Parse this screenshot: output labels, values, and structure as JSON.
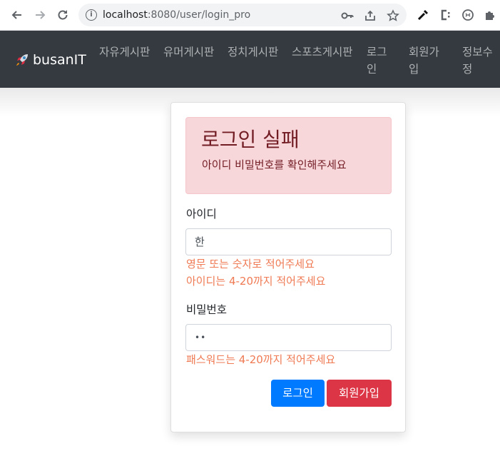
{
  "browser": {
    "url_host": "localhost",
    "url_rest": ":8080/user/login_pro",
    "back_icon": "arrow-left-icon",
    "forward_icon": "arrow-right-icon",
    "reload_icon": "reload-icon"
  },
  "navbar": {
    "brand": "busanIT",
    "items": [
      {
        "label": "자유게시판"
      },
      {
        "label": "유머게시판"
      },
      {
        "label": "정치게시판"
      },
      {
        "label": "스포츠게시판"
      },
      {
        "label": "로그인"
      },
      {
        "label": "회원가입"
      },
      {
        "label": "정보수정"
      }
    ]
  },
  "alert": {
    "title": "로그인 실패",
    "message": "아이디 비밀번호를 확인해주세요"
  },
  "form": {
    "id_label": "아이디",
    "id_value": "한",
    "id_errors": [
      "영문 또는 숫자로 적어주세요",
      "아이디는 4-20까지 적어주세요"
    ],
    "pw_label": "비밀번호",
    "pw_value": "••",
    "pw_error": "패스워드는 4-20까지 적어주세요",
    "login_button": "로그인",
    "join_button": "회원가입"
  },
  "colors": {
    "navbar": "#343a40",
    "primary": "#007bff",
    "danger": "#dc3545",
    "alert_bg": "#f8d7da",
    "error_text": "#ef7a53"
  }
}
